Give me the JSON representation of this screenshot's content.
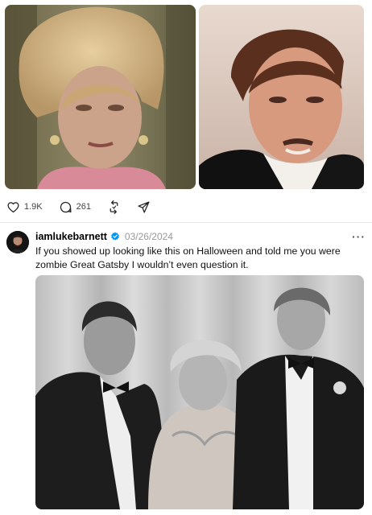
{
  "actions": {
    "likes": "1.9K",
    "replies": "261"
  },
  "post": {
    "username": "iamlukebarnett",
    "date": "03/26/2024",
    "more": "···",
    "text": "If you showed up looking like this on Halloween and told me you were zombie Great Gatsby I wouldn’t even question it."
  },
  "colors": {
    "verified": "#0095f6",
    "divider": "#e6e6e6",
    "date": "#999999"
  },
  "icons": [
    "heart-icon",
    "comment-icon",
    "repost-icon",
    "share-icon",
    "verified-badge-icon"
  ]
}
